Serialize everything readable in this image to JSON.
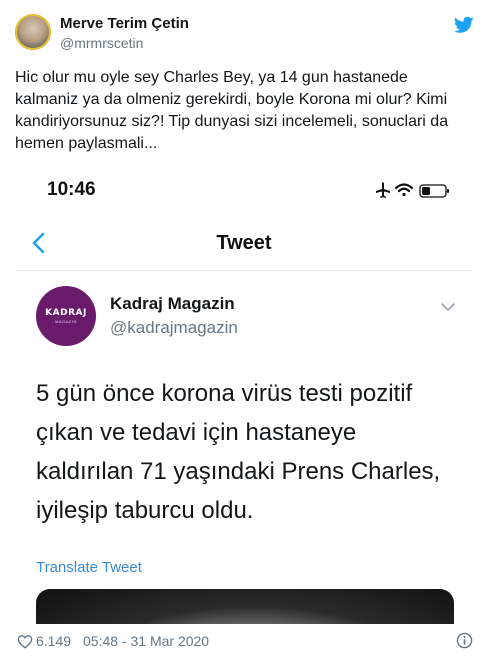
{
  "author": {
    "name": "Merve Terim Çetin",
    "handle": "@mrmrscetin"
  },
  "tweet_text": "Hic olur mu oyle sey Charles Bey, ya 14 gun hastanede kalmaniz ya da olmeniz gerekirdi, boyle Korona mi olur? Kimi kandiriyorsunuz siz?! Tip dunyasi sizi incelemeli, sonuclari da hemen paylasmali...",
  "embedded_screenshot": {
    "status_time": "10:46",
    "nav_title": "Tweet",
    "avatar_logo": "KADRAJ",
    "avatar_sub": "MAGAZIN",
    "author_name": "Kadraj Magazin",
    "author_handle": "@kadrajmagazin",
    "text": "5 gün önce korona virüs testi pozitif çıkan ve tedavi için hastaneye kaldırılan 71 yaşındaki Prens Charles, iyileşip taburcu oldu.",
    "translate_label": "Translate Tweet"
  },
  "footer": {
    "likes": "6.149",
    "datetime": "05:48 - 31 Mar 2020"
  },
  "colors": {
    "twitter_blue": "#1da1f2",
    "link_blue": "#3b8ad9",
    "kadraj_purple": "#6a1a6b",
    "muted": "#657786"
  },
  "icons": [
    "twitter-bird-icon",
    "back-chevron-icon",
    "airplane-icon",
    "wifi-icon",
    "battery-icon",
    "chevron-down-icon",
    "heart-icon",
    "info-icon"
  ]
}
